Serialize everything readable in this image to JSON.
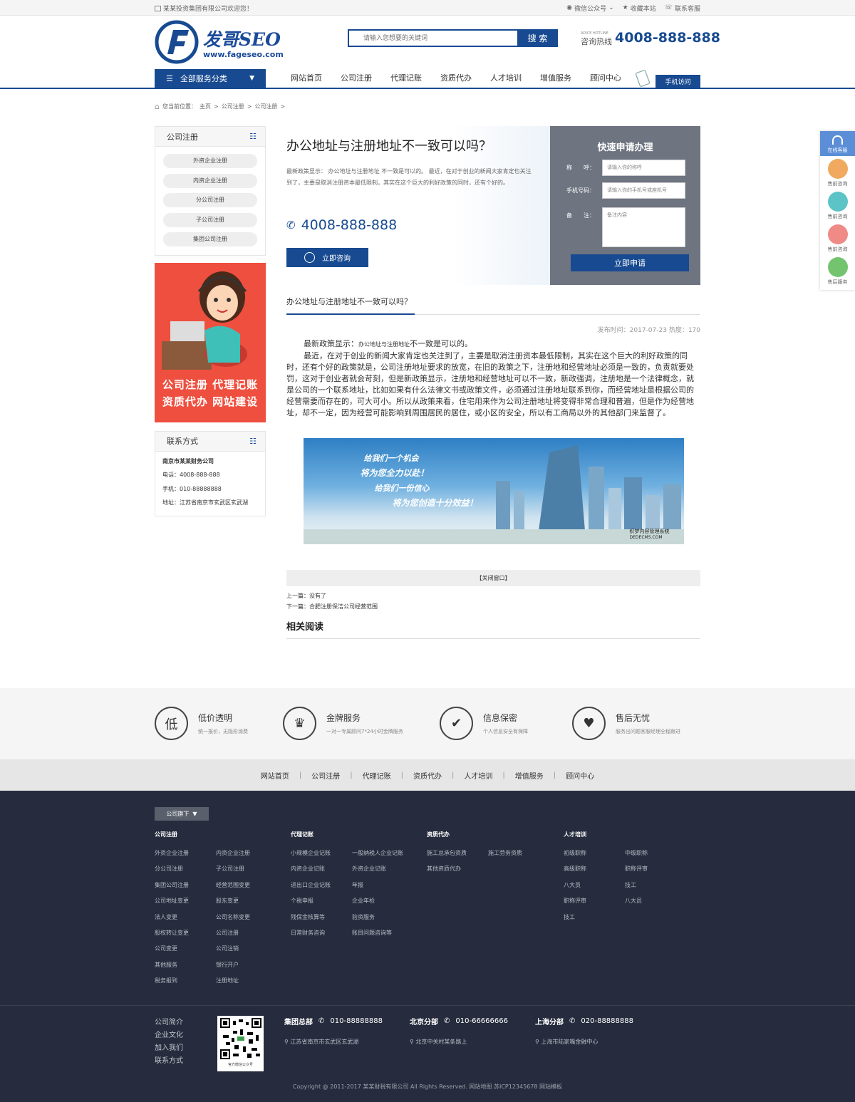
{
  "topbar": {
    "welcome": "某某投资集团有限公司欢迎您！",
    "wechat": "微信公众号",
    "favorite": "收藏本站",
    "service": "联系客服"
  },
  "header": {
    "logo_brand": "发哥SEO",
    "logo_url": "www.fageseo.com",
    "search_placeholder": "请输入您想要的关键词",
    "search_button": "搜 索",
    "hotline_small": "ADICE HOTLINE",
    "hotline_label": "咨询热线",
    "hotline_number": "4008-888-888"
  },
  "nav": {
    "category": "全部服务分类",
    "links": [
      "网站首页",
      "公司注册",
      "代理记账",
      "资质代办",
      "人才培训",
      "增值服务",
      "顾问中心"
    ],
    "mobile": "手机访问"
  },
  "breadcrumb": {
    "label": "您当前位置：",
    "items": [
      "主页",
      "公司注册",
      "公司注册"
    ]
  },
  "sidebar": {
    "cat_title": "公司注册",
    "cat_items": [
      "外资企业注册",
      "内资企业注册",
      "分公司注册",
      "子公司注册",
      "集团公司注册"
    ],
    "banner_line1": "公司注册 代理记账",
    "banner_line2": "资质代办 网站建设",
    "contact_title": "联系方式",
    "contact": [
      "南京市某某财务公司",
      "电话：4008-888-888",
      "手机：010-88888888",
      "地址：江苏省南京市玄武区玄武湖"
    ]
  },
  "hero": {
    "title": "办公地址与注册地址不一致可以吗？",
    "desc": "最新政策显示： 办公地址与注册地址 不一致是可以的。 最近，在对于创业的新闻大家肯定也关注到了，主要是取消注册资本最低限制，其实在这个巨大的利好政策的同时，还有个好的。",
    "tel": "4008-888-888",
    "consult": "立即咨询"
  },
  "form": {
    "title": "快速申请办理",
    "name_label": "称　　呼：",
    "name_ph": "请输入你的称呼",
    "phone_label": "手机号码：",
    "phone_ph": "请输入你的手机号或座机号",
    "note_label": "备　　注：",
    "note_ph": "备注内容",
    "submit": "立即申请"
  },
  "article": {
    "title": "办公地址与注册地址不一致可以吗？",
    "meta": "发布时间：2017-07-23 热度：170",
    "p1_a": "最新政策显示：",
    "p1_b": "办公地址与注册地址",
    "p1_c": "不一致是可以的。",
    "p2": "最近，在对于创业的新闻大家肯定也关注到了，主要是取消注册资本最低限制，其实在这个巨大的利好政策的同时，还有个好的政策就是，公司注册地址要求的放宽，在旧的政策之下，注册地和经营地址必须是一致的，负责就要处罚，这对于创业者就会苛刻，但是新政策显示，注册地和经营地址可以不一致，新政强调，注册地是一个法律概念，就是公司的一个联系地址，比如如果有什么法律文书或政策文件，必须通过注册地址联系到你，而经营地址是根据公司的经营需要而存在的，可大可小。所以从政策来看，住宅用来作为公司注册地址将变得非常合理和普遍，但是作为经营地址，却不一定，因为经营可能影响到周围居民的居住，或小区的安全，所以有工商局以外的其他部门来监督了。",
    "pic_lines": [
      "给我们一个机会",
      "将为您全力以赴！",
      "给我们一份信心",
      "将为您创造十分效益！"
    ],
    "pic_mark1": "织梦内容管理系统",
    "pic_mark2": "DEDECMS.COM",
    "close": "【关闭窗口】",
    "prev": "上一篇：没有了",
    "next": "下一篇：合肥注册保洁公司经营范围",
    "related": "相关阅读"
  },
  "float": {
    "top": "在线客服",
    "items": [
      "售前咨询",
      "售前咨询",
      "售前咨询",
      "售后服务"
    ]
  },
  "features": [
    {
      "icon": "低",
      "title": "低价透明",
      "sub": "统一报价，无隐形消费"
    },
    {
      "icon": "♛",
      "title": "金牌服务",
      "sub": "一对一专属顾问7*24小时金牌服务"
    },
    {
      "icon": "✔",
      "title": "信息保密",
      "sub": "个人信息安全有保障"
    },
    {
      "icon": "♥",
      "title": "售后无忧",
      "sub": "服务出问题客服经理全程跟进"
    }
  ],
  "footnav": [
    "网站首页",
    "公司注册",
    "代理记账",
    "资质代办",
    "人才培训",
    "增值服务",
    "顾问中心"
  ],
  "footer": {
    "tag": "公司旗下",
    "cols": [
      {
        "title": "公司注册",
        "items": [
          "外资企业注册",
          "内资企业注册",
          "分公司注册",
          "子公司注册",
          "集团公司注册",
          "经营范围变更",
          "公司地址变更",
          "股东变更",
          "法人变更",
          "公司名称变更",
          "股权转让变更",
          "公司注册",
          "公司变更",
          "公司注销",
          "其他服务",
          "银行开户",
          "税务报到",
          "注册地址"
        ]
      },
      {
        "title": "代理记账",
        "items": [
          "小规模企业记账",
          "一般纳税人企业记账",
          "内资企业记账",
          "外资企业记账",
          "进出口企业记账",
          "年报",
          "个税申报",
          "企业年检",
          "残保金核算等",
          "验资服务",
          "日常财务咨询",
          "账目问题咨询等"
        ]
      },
      {
        "title": "资质代办",
        "items": [
          "施工总承包资质",
          "施工劳务资质",
          "其他资质代办"
        ]
      },
      {
        "title": "人才培训",
        "items": [
          "初级职称",
          "中级职称",
          "高级职称",
          "职称评审",
          "八大员",
          "技工",
          "职称评审",
          "八大员",
          "技工"
        ]
      }
    ],
    "links": [
      "公司简介",
      "企业文化",
      "加入我们",
      "联系方式"
    ],
    "qr_caption": "官方微信公众号",
    "branches": [
      {
        "name": "集团总部",
        "tel": "010-88888888",
        "addr": "江苏省南京市玄武区玄武湖"
      },
      {
        "name": "北京分部",
        "tel": "010-66666666",
        "addr": "北京中关村某条路上"
      },
      {
        "name": "上海分部",
        "tel": "020-88888888",
        "addr": "上海市陆家嘴金融中心"
      }
    ],
    "copyright": "Copyright @ 2011-2017 某某财税有限公司 All Rights Reserved.   网站地图   苏ICP12345678   网站模板"
  },
  "colors": {
    "primary": "#184a91",
    "footer_bg": "#262c3d"
  }
}
